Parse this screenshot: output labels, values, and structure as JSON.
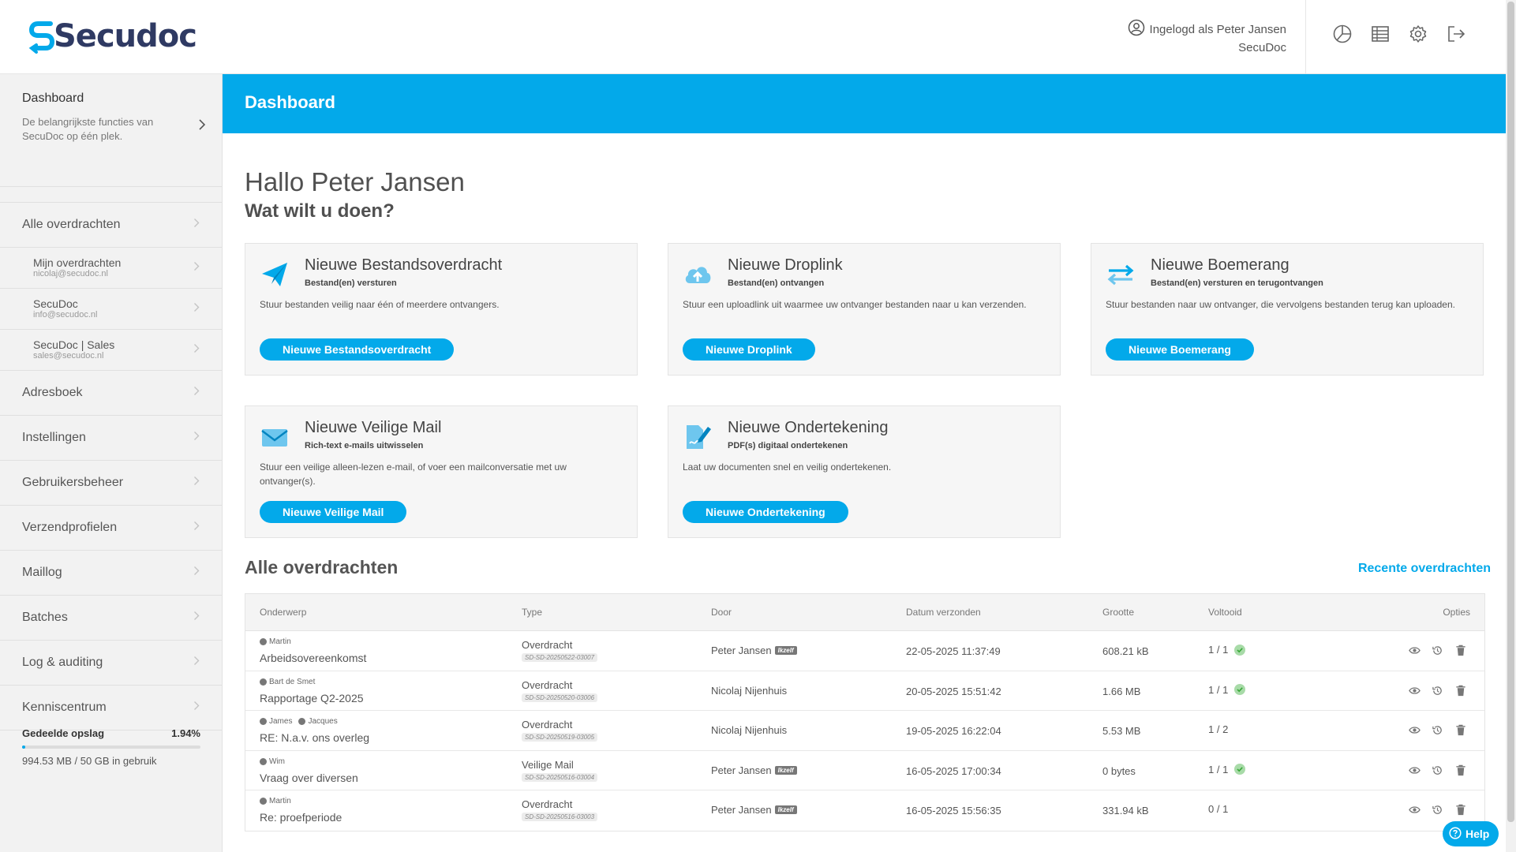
{
  "brand": {
    "name": "Secudoc",
    "accent": "#03a9ea",
    "logo_color": "#2f3a63"
  },
  "header": {
    "user_line": "Ingelogd als Peter Jansen",
    "org": "SecuDoc",
    "icons": [
      "pie-chart-icon",
      "table-icon",
      "settings-gear-icon",
      "logout-icon"
    ]
  },
  "sidebar": {
    "dashboard": {
      "title": "Dashboard",
      "desc": "De belangrijkste functies van SecuDoc op één plek."
    },
    "alle_overdrachten": "Alle overdrachten",
    "mailboxes": [
      {
        "name": "Mijn overdrachten",
        "mail": "nicolaj@secudoc.nl"
      },
      {
        "name": "SecuDoc",
        "mail": "info@secudoc.nl"
      },
      {
        "name": "SecuDoc | Sales",
        "mail": "sales@secudoc.nl"
      }
    ],
    "items": [
      "Adresboek",
      "Instellingen",
      "Gebruikersbeheer",
      "Verzendprofielen",
      "Maillog",
      "Batches",
      "Log & auditing",
      "Kenniscentrum"
    ],
    "storage": {
      "label": "Gedeelde opslag",
      "percent": "1.94%",
      "fraction": 0.0194,
      "used": "994.53 MB / 50 GB in gebruik"
    }
  },
  "main": {
    "banner_title": "Dashboard",
    "greeting": "Hallo Peter Jansen",
    "question": "Wat wilt u doen?",
    "cards": [
      {
        "title": "Nieuwe Bestandsoverdracht",
        "sub": "Bestand(en) versturen",
        "desc": "Stuur bestanden veilig naar één of meerdere ontvangers.",
        "button": "Nieuwe Bestandsoverdracht",
        "icon": "paper-plane-icon"
      },
      {
        "title": "Nieuwe Droplink",
        "sub": "Bestand(en) ontvangen",
        "desc": "Stuur een uploadlink uit waarmee uw ontvanger bestanden naar u kan verzenden.",
        "button": "Nieuwe Droplink",
        "icon": "cloud-upload-icon"
      },
      {
        "title": "Nieuwe Boemerang",
        "sub": "Bestand(en) versturen en terugontvangen",
        "desc": "Stuur bestanden naar uw ontvanger, die vervolgens bestanden terug kan uploaden.",
        "button": "Nieuwe Boemerang",
        "icon": "swap-arrows-icon"
      },
      {
        "title": "Nieuwe Veilige Mail",
        "sub": "Rich-text e-mails uitwisselen",
        "desc": "Stuur een veilige alleen-lezen e-mail, of voer een mailconversatie met uw ontvanger(s).",
        "button": "Nieuwe Veilige Mail",
        "icon": "envelope-icon"
      },
      {
        "title": "Nieuwe Ondertekening",
        "sub": "PDF(s) digitaal ondertekenen",
        "desc": "Laat uw documenten snel en veilig ondertekenen.",
        "button": "Nieuwe Ondertekening",
        "icon": "sign-document-icon"
      }
    ],
    "transfers": {
      "title": "Alle overdrachten",
      "link": "Recente overdrachten",
      "columns": [
        "Onderwerp",
        "Type",
        "Door",
        "Datum verzonden",
        "Grootte",
        "Voltooid",
        "Opties"
      ],
      "rows": [
        {
          "people": [
            "Martin"
          ],
          "subject": "Arbeidsovereenkomst",
          "type": "Overdracht",
          "code": "SD-SD-20250522-03007",
          "by": "Peter Jansen",
          "self": "Ikzelf",
          "date": "22-05-2025 11:37:49",
          "size": "608.21 kB",
          "done": "1 / 1",
          "complete": true
        },
        {
          "people": [
            "Bart de Smet"
          ],
          "subject": "Rapportage Q2-2025",
          "type": "Overdracht",
          "code": "SD-SD-20250520-03006",
          "by": "Nicolaj Nijenhuis",
          "self": "",
          "date": "20-05-2025 15:51:42",
          "size": "1.66 MB",
          "done": "1 / 1",
          "complete": true
        },
        {
          "people": [
            "James",
            "Jacques"
          ],
          "subject": "RE: N.a.v. ons overleg",
          "type": "Overdracht",
          "code": "SD-SD-20250519-03005",
          "by": "Nicolaj Nijenhuis",
          "self": "",
          "date": "19-05-2025 16:22:04",
          "size": "5.53 MB",
          "done": "1 / 2",
          "complete": false
        },
        {
          "people": [
            "Wim"
          ],
          "subject": "Vraag over diversen",
          "type": "Veilige Mail",
          "code": "SD-SD-20250516-03004",
          "by": "Peter Jansen",
          "self": "Ikzelf",
          "date": "16-05-2025 17:00:34",
          "size": "0 bytes",
          "done": "1 / 1",
          "complete": true
        },
        {
          "people": [
            "Martin"
          ],
          "subject": "Re: proefperiode",
          "type": "Overdracht",
          "code": "SD-SD-20250516-03003",
          "by": "Peter Jansen",
          "self": "Ikzelf",
          "date": "16-05-2025 15:56:35",
          "size": "331.94 kB",
          "done": "0 / 1",
          "complete": false
        }
      ]
    }
  },
  "help": {
    "label": "Help"
  }
}
